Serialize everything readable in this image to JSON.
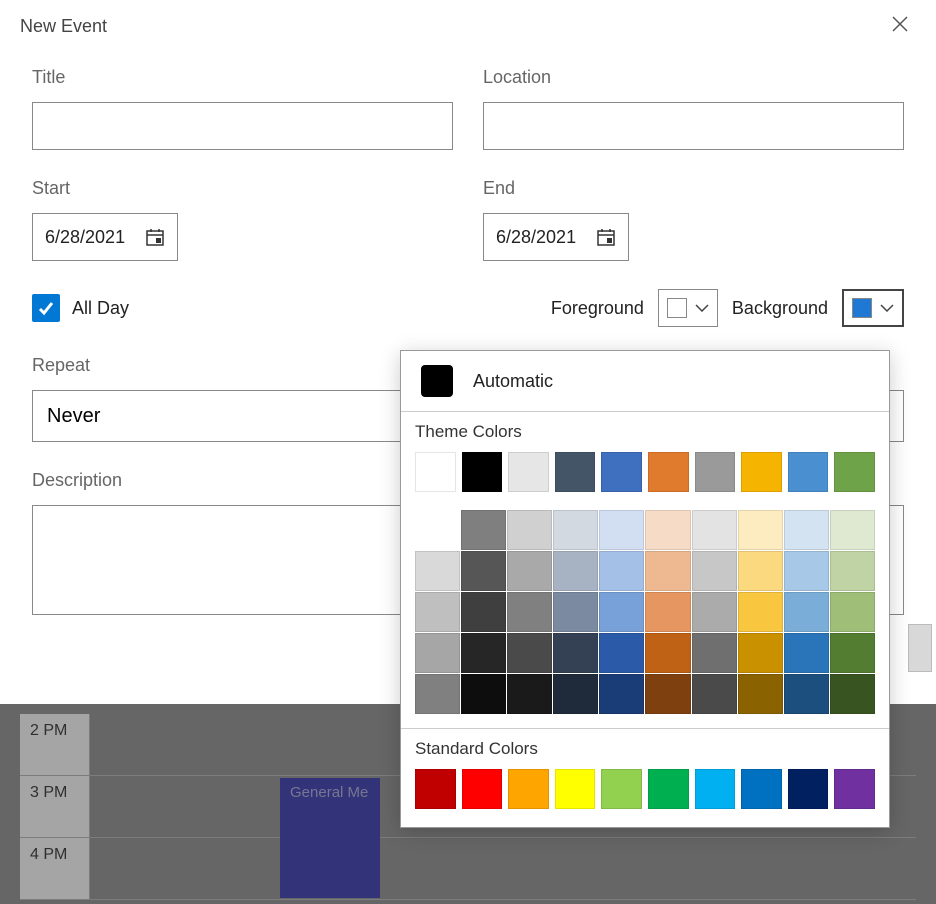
{
  "dialog": {
    "title": "New Event",
    "titleLabel": "Title",
    "titleValue": "",
    "locationLabel": "Location",
    "locationValue": "",
    "startLabel": "Start",
    "startValue": "6/28/2021",
    "endLabel": "End",
    "endValue": "6/28/2021",
    "allDayLabel": "All Day",
    "allDayChecked": true,
    "foregroundLabel": "Foreground",
    "foregroundColor": "#ffffff",
    "backgroundLabel": "Background",
    "backgroundColor": "#1f78d4",
    "repeatLabel": "Repeat",
    "repeatValue": "Never",
    "descriptionLabel": "Description",
    "descriptionValue": ""
  },
  "calendar": {
    "times": [
      "2 PM",
      "3 PM",
      "4 PM"
    ],
    "eventTitle": "General Me"
  },
  "colorPicker": {
    "automaticLabel": "Automatic",
    "automaticColor": "#000000",
    "themeLabel": "Theme Colors",
    "standardLabel": "Standard Colors",
    "themeRow0": [
      "#ffffff",
      "#000000",
      "#e6e6e6",
      "#445568",
      "#3f6fbf",
      "#e07b2d",
      "#9a9a9a",
      "#f5b400",
      "#4a8fd0",
      "#6fa34a"
    ],
    "themeShadeRows": [
      [
        "",
        "#7f7f7f",
        "#d0d0d0",
        "#d3d9e1",
        "#d2dff2",
        "#f6dcc7",
        "#e3e3e3",
        "#fdecbf",
        "#d3e3f2",
        "#dfe9d1"
      ],
      [
        "#d9d9d9",
        "#565656",
        "#a9a9a9",
        "#a7b3c3",
        "#a5c0e6",
        "#eeb991",
        "#c7c7c7",
        "#fbd97f",
        "#a7c8e6",
        "#bfd3a4"
      ],
      [
        "#bfbfbf",
        "#3f3f3f",
        "#808080",
        "#7b8aa0",
        "#78a0d9",
        "#e69660",
        "#ababab",
        "#f9c640",
        "#7aaed9",
        "#9fbe77"
      ],
      [
        "#a6a6a6",
        "#262626",
        "#4a4a4a",
        "#344054",
        "#2b5aa9",
        "#c06216",
        "#6f6f6f",
        "#c99000",
        "#2a74b9",
        "#537e31"
      ],
      [
        "#808080",
        "#0d0d0d",
        "#1a1a1a",
        "#1f2b3a",
        "#1b3d77",
        "#7f400f",
        "#4a4a4a",
        "#8a6300",
        "#1c4e7e",
        "#385521"
      ]
    ],
    "standardColors": [
      "#c00000",
      "#ff0000",
      "#ffa500",
      "#ffff00",
      "#92d050",
      "#00b050",
      "#00b0f0",
      "#0070c0",
      "#002060",
      "#7030a0"
    ]
  }
}
